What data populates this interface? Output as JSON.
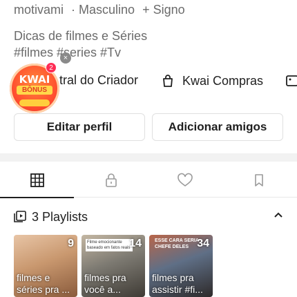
{
  "profile": {
    "meta": [
      "motivami",
      "· Masculino",
      "+ Signo"
    ],
    "bio_line1": "Dicas de filmes e Séries",
    "bio_line2": "#filmes #series #Tv"
  },
  "shortcuts": {
    "creator_center": "tral do Criador",
    "kwai_shopping": "Kwai Compras"
  },
  "bonus": {
    "brand": "KWAI",
    "label": "BÔNUS",
    "count": "2",
    "close": "×"
  },
  "buttons": {
    "edit_profile": "Editar perfil",
    "add_friends": "Adicionar amigos"
  },
  "tabs": [
    {
      "icon": "grid-icon",
      "active": true
    },
    {
      "icon": "lock-icon",
      "active": false
    },
    {
      "icon": "heart-icon",
      "active": false
    },
    {
      "icon": "bookmark-icon",
      "active": false
    }
  ],
  "playlists": {
    "header": "3 Playlists",
    "items": [
      {
        "count": "9",
        "title": "filmes e séries pra ...",
        "colors": [
          "#c9986f",
          "#e8c5a6",
          "#8a5b3c"
        ]
      },
      {
        "count": "14",
        "title": "filmes pra você a...",
        "caption": "Filme emocionante baseado em fatos reais",
        "colors": [
          "#7d7a72",
          "#c4b7a3",
          "#3f3b35"
        ]
      },
      {
        "count": "34",
        "title": "filmes pra assistir #fi...",
        "caption": "ESSE CARA SERIA CHEFE DELES",
        "colors": [
          "#5f6f86",
          "#b8664a",
          "#2e2a2a"
        ]
      }
    ]
  }
}
